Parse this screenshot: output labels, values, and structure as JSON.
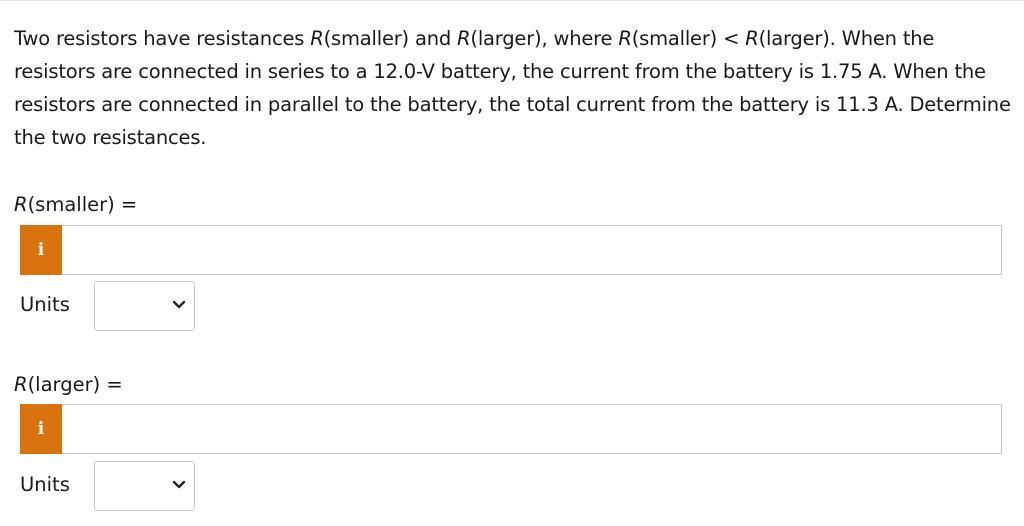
{
  "question": {
    "part1": "Two resistors have resistances ",
    "var_smaller": "R",
    "part2": "(smaller) and ",
    "var_larger": "R",
    "part3": "(larger), where ",
    "var_smaller_2": "R",
    "part4": "(smaller) < ",
    "var_larger_2": "R",
    "part5": "(larger). When the resistors are connected in series to a 12.0-V battery, the current from the battery is 1.75 A. When the resistors are connected in parallel to the battery, the total current from the battery is 11.3 A. Determine the two resistances."
  },
  "answers": [
    {
      "label_var": "R",
      "label_rest": "(smaller) =",
      "info_icon_glyph": "i",
      "input_value": "",
      "units_label": "Units",
      "units_selected": ""
    },
    {
      "label_var": "R",
      "label_rest": "(larger) =",
      "info_icon_glyph": "i",
      "input_value": "",
      "units_label": "Units",
      "units_selected": ""
    }
  ],
  "colors": {
    "info_button": "#d9730d",
    "border": "#c8c8c8"
  },
  "icons": {
    "info": "info-icon",
    "dropdown": "chevron-down-icon"
  }
}
